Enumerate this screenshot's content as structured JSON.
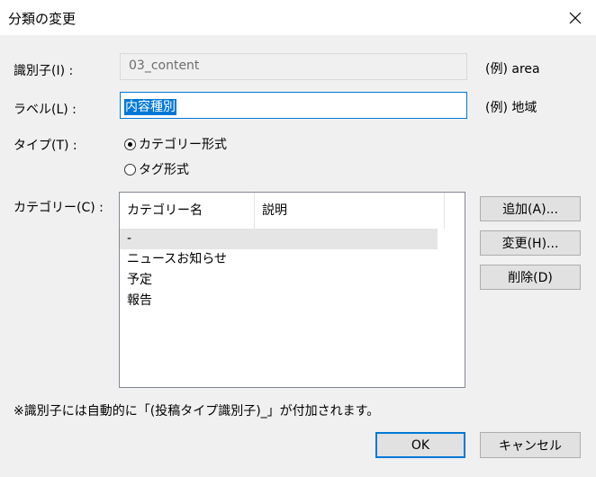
{
  "window": {
    "title": "分類の変更"
  },
  "form": {
    "identifier": {
      "label": "識別子(I) :",
      "value": "03_content",
      "example": "(例) area"
    },
    "label": {
      "label": "ラベル(L) :",
      "value": "内容種別",
      "example": "(例) 地域"
    },
    "type": {
      "label": "タイプ(T) :",
      "options": [
        {
          "label": "カテゴリー形式",
          "selected": true
        },
        {
          "label": "タグ形式",
          "selected": false
        }
      ]
    },
    "categories": {
      "label": "カテゴリー(C) :",
      "columns": [
        "カテゴリー名",
        "説明"
      ],
      "rows": [
        "-",
        "ニュースお知らせ",
        "予定",
        "報告"
      ],
      "buttons": {
        "add": "追加(A)...",
        "edit": "変更(H)...",
        "delete": "削除(D)"
      }
    }
  },
  "note": "※識別子には自動的に「(投稿タイプ識別子)_」が付加されます。",
  "footer": {
    "ok": "OK",
    "cancel": "キャンセル"
  },
  "colors": {
    "accent": "#0078d7",
    "background": "#f0f0f0"
  }
}
